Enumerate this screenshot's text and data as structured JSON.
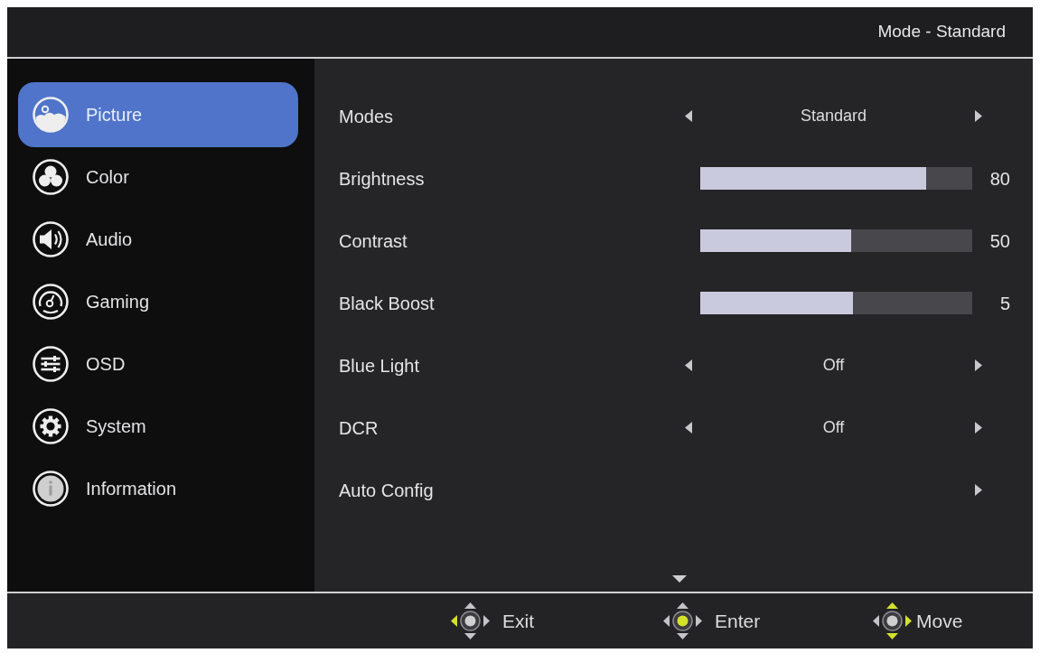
{
  "header": {
    "title": "Mode - Standard"
  },
  "sidebar": {
    "items": [
      {
        "label": "Picture",
        "selected": true
      },
      {
        "label": "Color",
        "selected": false
      },
      {
        "label": "Audio",
        "selected": false
      },
      {
        "label": "Gaming",
        "selected": false
      },
      {
        "label": "OSD",
        "selected": false
      },
      {
        "label": "System",
        "selected": false
      },
      {
        "label": "Information",
        "selected": false
      }
    ]
  },
  "settings": {
    "rows": [
      {
        "kind": "choice",
        "label": "Modes",
        "value": "Standard"
      },
      {
        "kind": "slider",
        "label": "Brightness",
        "level": 0.83,
        "reading": "80"
      },
      {
        "kind": "slider",
        "label": "Contrast",
        "level": 0.555,
        "reading": "50"
      },
      {
        "kind": "slider",
        "label": "Black Boost",
        "level": 0.56,
        "reading": "5"
      },
      {
        "kind": "choice",
        "label": "Blue Light",
        "value": "Off"
      },
      {
        "kind": "choice",
        "label": "DCR",
        "value": "Off"
      },
      {
        "kind": "submenu",
        "label": "Auto Config"
      }
    ]
  },
  "footer": {
    "hints": [
      {
        "label": "Exit",
        "lit": {
          "up": false,
          "down": false,
          "left": true,
          "right": false,
          "center": false
        }
      },
      {
        "label": "Enter",
        "lit": {
          "up": false,
          "down": false,
          "left": false,
          "right": false,
          "center": true
        }
      },
      {
        "label": "Move",
        "lit": {
          "up": true,
          "down": true,
          "left": false,
          "right": true,
          "center": false
        }
      }
    ]
  }
}
